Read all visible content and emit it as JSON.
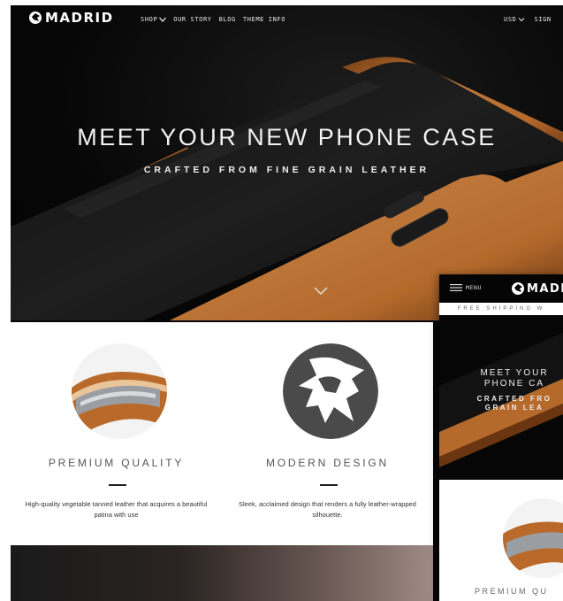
{
  "brand": {
    "name": "MADRID"
  },
  "nav": {
    "items": [
      {
        "label": "SHOP",
        "has_dropdown": true
      },
      {
        "label": "OUR STORY"
      },
      {
        "label": "BLOG"
      },
      {
        "label": "THEME INFO"
      }
    ],
    "currency": "USD",
    "sign_in": "SIGN"
  },
  "hero": {
    "title": "MEET YOUR NEW PHONE CASE",
    "subtitle": "CRAFTED FROM FINE GRAIN LEATHER"
  },
  "features": [
    {
      "title": "PREMIUM QUALITY",
      "description": "High-quality vegetable tanned leather that acquires a beautiful patina with use",
      "icon": "leather-case-photo"
    },
    {
      "title": "MODERN DESIGN",
      "description": "Sleek, acclaimed design that renders a fully leather-wrapped silhouette.",
      "icon": "bull-logo"
    }
  ],
  "mobile": {
    "menu_label": "MENU",
    "brand": "MADR",
    "shipping_banner": "FREE SHIPPING W",
    "hero_title_lines": [
      "MEET YOUR",
      "PHONE CA"
    ],
    "hero_subtitle_lines": [
      "CRAFTED FRO",
      "GRAIN LEA"
    ],
    "feature_title": "PREMIUM QU"
  },
  "colors": {
    "leather": "#b9682a",
    "background_dark": "#060606",
    "logo_grey": "#4a4a4a"
  }
}
